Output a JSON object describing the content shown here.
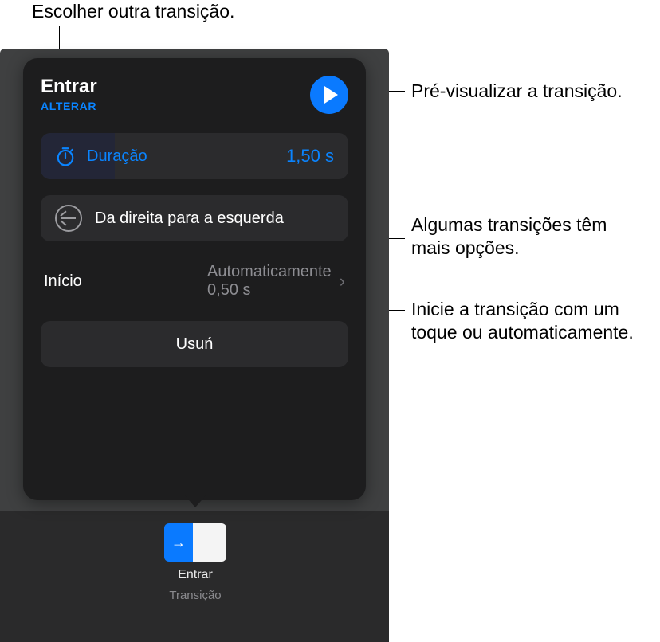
{
  "callouts": {
    "choose_other": "Escolher outra transição.",
    "preview": "Pré-visualizar a transição.",
    "more_options": "Algumas transições têm mais opções.",
    "start_info": "Inicie a transição com um toque ou automaticamente."
  },
  "panel": {
    "title": "Entrar",
    "change_label": "ALTERAR",
    "duration": {
      "label": "Duração",
      "value": "1,50 s"
    },
    "direction": {
      "label": "Da direita para a esquerda"
    },
    "start": {
      "label": "Início",
      "mode": "Automaticamente",
      "delay": "0,50 s"
    },
    "delete_label": "Usuń"
  },
  "chip": {
    "title": "Entrar",
    "subtitle": "Transição"
  }
}
